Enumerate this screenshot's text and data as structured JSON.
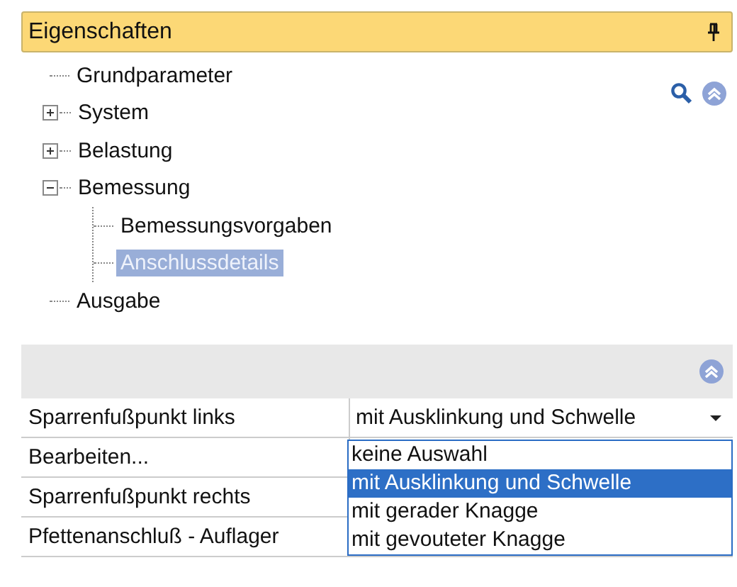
{
  "panel": {
    "title": "Eigenschaften"
  },
  "tree": [
    {
      "label": "Grundparameter",
      "selected": false
    },
    {
      "label": "System",
      "expanded": false,
      "selected": false
    },
    {
      "label": "Belastung",
      "expanded": false,
      "selected": false
    },
    {
      "label": "Bemessung",
      "expanded": true,
      "selected": false,
      "children": [
        {
          "label": "Bemessungsvorgaben",
          "selected": false
        },
        {
          "label": "Anschlussdetails",
          "selected": true
        }
      ]
    },
    {
      "label": "Ausgabe",
      "selected": false
    }
  ],
  "properties": [
    {
      "label": "Sparrenfußpunkt links",
      "kind": "dropdown",
      "value": "mit Ausklinkung und Schwelle",
      "open": true,
      "options": [
        {
          "label": "keine Auswahl",
          "selected": false
        },
        {
          "label": "mit Ausklinkung und Schwelle",
          "selected": true
        },
        {
          "label": "mit gerader Knagge",
          "selected": false
        },
        {
          "label": "mit gevouteter Knagge",
          "selected": false
        }
      ]
    },
    {
      "label": "Bearbeiten...",
      "kind": "button"
    },
    {
      "label": "Sparrenfußpunkt rechts",
      "kind": "dropdown"
    },
    {
      "label": "Pfettenanschluß - Auflager",
      "kind": "dropdown"
    }
  ]
}
